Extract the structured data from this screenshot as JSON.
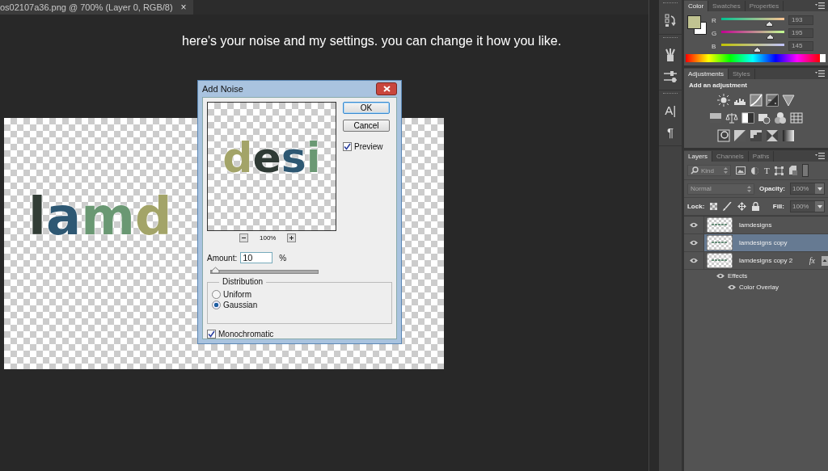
{
  "document_tab": {
    "title": "os02107a36.png @ 700% (Layer 0, RGB/8)",
    "close": "×"
  },
  "caption": "here's your noise and my settings. you can change it how you like.",
  "canvas": {
    "letters_left": [
      {
        "text": "l",
        "color": "#323d36"
      },
      {
        "text": "a",
        "color": "#2e5873"
      },
      {
        "text": "m",
        "color": "#6a9873"
      },
      {
        "text": "d",
        "color": "#a3a468"
      }
    ]
  },
  "dialog": {
    "title": "Add Noise",
    "preview_letters": [
      {
        "text": "d",
        "color": "#a3a468"
      },
      {
        "text": "e",
        "color": "#2f3a35"
      },
      {
        "text": "s",
        "color": "#2e5873"
      },
      {
        "text": "i",
        "color": "#6a9873"
      }
    ],
    "zoom": "100%",
    "buttons": [
      {
        "label": "OK",
        "default": true
      },
      {
        "label": "Cancel",
        "default": false
      }
    ],
    "preview": {
      "label": "Preview",
      "checked": true
    },
    "amount": {
      "label": "Amount:",
      "value": "10",
      "unit": "%",
      "level": 0.025
    },
    "distribution": {
      "title": "Distribution",
      "options": [
        {
          "label": "Uniform",
          "selected": false
        },
        {
          "label": "Gaussian",
          "selected": true
        }
      ]
    },
    "monochromatic": {
      "label": "Monochromatic",
      "checked": true
    }
  },
  "tool_glyphs": [
    "A|",
    "¶"
  ],
  "color_panel": {
    "tabs": [
      {
        "label": "Color",
        "selected": true
      },
      {
        "label": "Swatches",
        "selected": false
      },
      {
        "label": "Properties",
        "selected": false
      }
    ],
    "foreground": {
      "color": "#c1c391"
    },
    "channels": [
      {
        "name": "R",
        "value": "193",
        "level": 0.757
      },
      {
        "name": "G",
        "value": "195",
        "level": 0.765
      },
      {
        "name": "B",
        "value": "145",
        "level": 0.569
      }
    ]
  },
  "adjustments_panel": {
    "tabs": [
      {
        "label": "Adjustments",
        "selected": true
      },
      {
        "label": "Styles",
        "selected": false
      }
    ],
    "heading": "Add an adjustment"
  },
  "layers_panel": {
    "tabs": [
      {
        "label": "Layers",
        "selected": true
      },
      {
        "label": "Channels",
        "selected": false
      },
      {
        "label": "Paths",
        "selected": false
      }
    ],
    "filter_kind": "Kind",
    "type_glyph": "T",
    "blend_mode": "Normal",
    "opacity_label": "Opacity:",
    "opacity": "100%",
    "lock_label": "Lock:",
    "fill_label": "Fill:",
    "fill": "100%",
    "layers": [
      {
        "name": "lamdesigns",
        "selected": false,
        "visible": true
      },
      {
        "name": "lamdesigns copy",
        "selected": true,
        "visible": true
      },
      {
        "name": "lamdesigns copy 2",
        "selected": false,
        "visible": true,
        "fx": "fx",
        "children": [
          {
            "name": "Effects",
            "visible": true,
            "children": [
              {
                "name": "Color Overlay",
                "visible": true
              }
            ]
          }
        ]
      }
    ]
  }
}
